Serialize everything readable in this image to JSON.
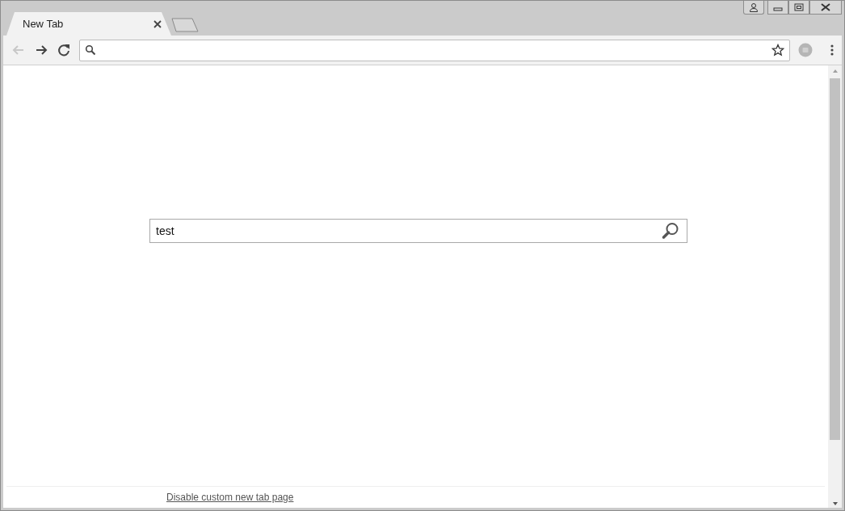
{
  "tabs": [
    {
      "label": "New Tab",
      "selected": true
    }
  ],
  "nav_buttons": [
    {
      "kind": "back",
      "disabled": true
    },
    {
      "kind": "forward",
      "disabled": false
    },
    {
      "kind": "reload",
      "disabled": false
    }
  ],
  "page": {
    "search": {
      "value": "test"
    },
    "footer_link": "Disable custom new tab page"
  }
}
